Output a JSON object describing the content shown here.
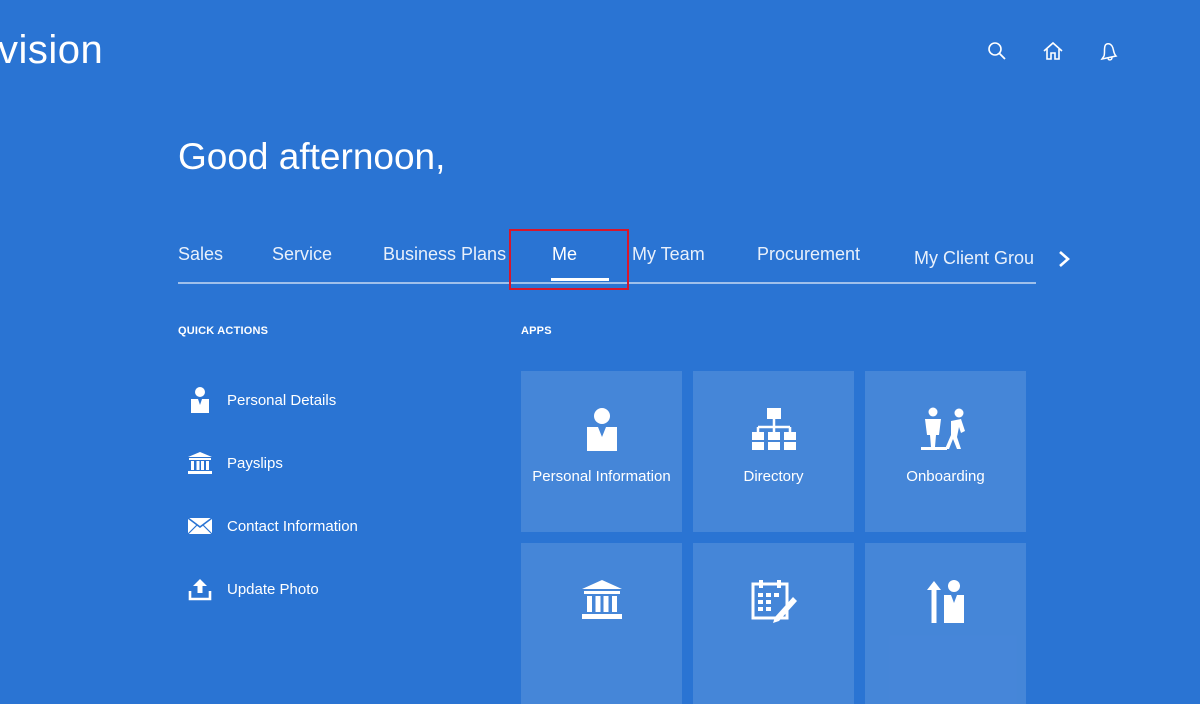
{
  "header": {
    "logo_text": "vision",
    "icons": [
      "search-icon",
      "home-icon",
      "bell-icon"
    ]
  },
  "greeting": "Good afternoon,",
  "tabs": [
    {
      "label": "Sales"
    },
    {
      "label": "Service"
    },
    {
      "label": "Business Plans"
    },
    {
      "label": "Me",
      "active": true
    },
    {
      "label": "My Team"
    },
    {
      "label": "Procurement"
    },
    {
      "label": "My Client Grou"
    }
  ],
  "quick_actions": {
    "title": "QUICK ACTIONS",
    "items": [
      {
        "label": "Personal Details",
        "icon": "person-icon"
      },
      {
        "label": "Payslips",
        "icon": "bank-icon"
      },
      {
        "label": "Contact Information",
        "icon": "envelope-icon"
      },
      {
        "label": "Update Photo",
        "icon": "upload-icon"
      }
    ]
  },
  "apps": {
    "title": "APPS",
    "tiles": [
      {
        "label": "Personal Information",
        "icon": "person-icon"
      },
      {
        "label": "Directory",
        "icon": "org-chart-icon"
      },
      {
        "label": "Onboarding",
        "icon": "onboarding-icon"
      },
      {
        "label": "",
        "icon": "bank-icon"
      },
      {
        "label": "",
        "icon": "calendar-edit-icon"
      },
      {
        "label": "",
        "icon": "career-icon"
      }
    ]
  },
  "colors": {
    "background": "#2a74d3",
    "highlight_box": "#d9162b",
    "tile": "rgba(255,255,255,0.13)"
  }
}
